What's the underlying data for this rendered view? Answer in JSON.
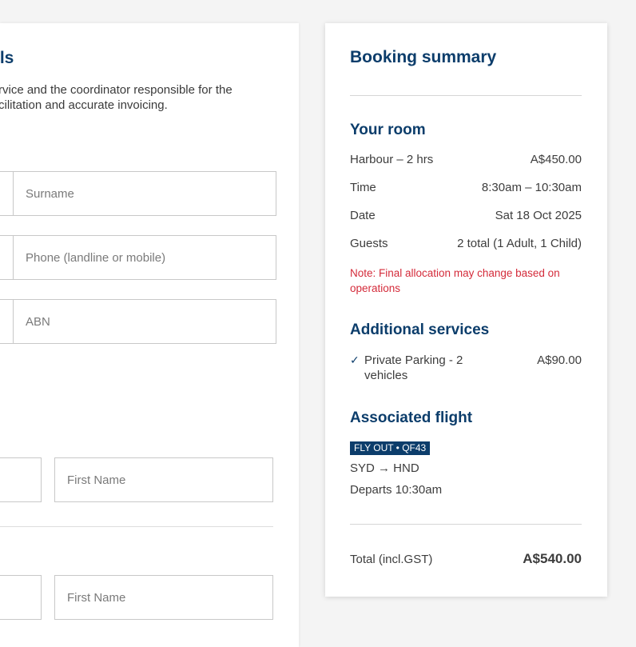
{
  "form": {
    "heading": "ils",
    "description_line1": "rvice and the coordinator responsible for the",
    "description_line2": "cilitation and accurate invoicing.",
    "surname_placeholder": "Surname",
    "phone_placeholder": "Phone (landline or mobile)",
    "abn_placeholder": "ABN",
    "first_name_placeholder_1": "First Name",
    "first_name_placeholder_2": "First Name"
  },
  "summary": {
    "title": "Booking summary",
    "room": {
      "heading": "Your room",
      "rows": [
        {
          "label": "Harbour – 2 hrs",
          "value": "A$450.00"
        },
        {
          "label": "Time",
          "value": "8:30am – 10:30am"
        },
        {
          "label": "Date",
          "value": "Sat 18 Oct 2025"
        },
        {
          "label": "Guests",
          "value": "2 total (1 Adult, 1 Child)"
        }
      ],
      "note": "Note: Final allocation may change based on operations"
    },
    "services": {
      "heading": "Additional services",
      "check": "✓",
      "item_label": "Private Parking - 2 vehicles",
      "item_price": "A$90.00"
    },
    "flight": {
      "heading": "Associated flight",
      "badge": "FLY OUT • QF43",
      "route": "SYD → HND",
      "departs": "Departs 10:30am"
    },
    "total": {
      "label": "Total (incl.GST)",
      "value": "A$540.00"
    }
  },
  "colors": {
    "brand_navy": "#0c3d6b",
    "note_red": "#d42b3a",
    "background": "#f4f4f4"
  }
}
